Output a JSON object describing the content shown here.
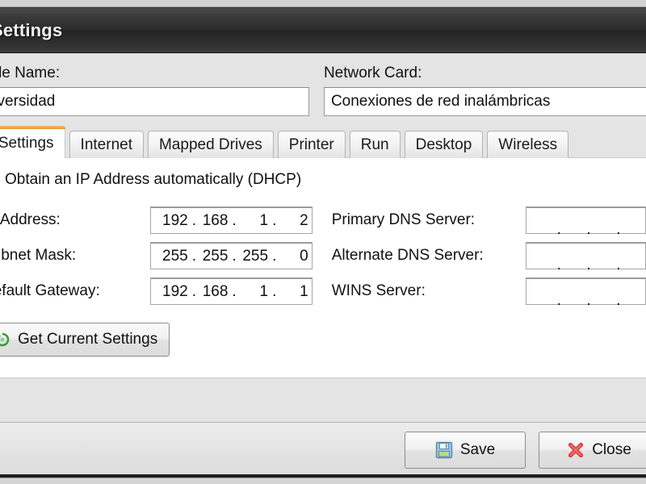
{
  "window": {
    "title": "Settings",
    "title_icon": "app-icon"
  },
  "top_fields": {
    "profile": {
      "label": "Profile Name:",
      "value": "Universidad"
    },
    "network_card": {
      "label": "Network Card:",
      "value": "Conexiones de red inalámbricas"
    }
  },
  "tabs": [
    {
      "label": "IP Settings",
      "active": true
    },
    {
      "label": "Internet",
      "active": false
    },
    {
      "label": "Mapped Drives",
      "active": false
    },
    {
      "label": "Printer",
      "active": false
    },
    {
      "label": "Run",
      "active": false
    },
    {
      "label": "Desktop",
      "active": false
    },
    {
      "label": "Wireless",
      "active": false
    }
  ],
  "ip_settings": {
    "dhcp_checkbox": {
      "label": "Obtain an IP Address automatically (DHCP)",
      "checked": false
    },
    "left_fields": [
      {
        "label": "IP Address:",
        "octets": [
          "192",
          "168",
          "1",
          "2"
        ]
      },
      {
        "label": "Subnet Mask:",
        "octets": [
          "255",
          "255",
          "255",
          "0"
        ]
      },
      {
        "label": "Default Gateway:",
        "octets": [
          "192",
          "168",
          "1",
          "1"
        ]
      }
    ],
    "right_fields": [
      {
        "label": "Primary DNS Server:",
        "octets": [
          "",
          "",
          "",
          ""
        ]
      },
      {
        "label": "Alternate DNS Server:",
        "octets": [
          "",
          "",
          "",
          ""
        ]
      },
      {
        "label": "WINS Server:",
        "octets": [
          "",
          "",
          "",
          ""
        ]
      }
    ],
    "get_current_button": {
      "label": "Get Current Settings",
      "icon": "refresh-green-icon"
    }
  },
  "footer": {
    "save_button": {
      "label": "Save",
      "icon": "floppy-disk-icon"
    },
    "close_button": {
      "label": "Close",
      "icon": "red-x-icon"
    }
  },
  "colors": {
    "titlebar": "#2c2c2c",
    "active_tab_accent": "#e09a2c",
    "dialog_background": "#e4e4e4",
    "panel_background": "#ffffff",
    "close_icon": "#d94040",
    "save_icon": "#6f9fd0"
  }
}
